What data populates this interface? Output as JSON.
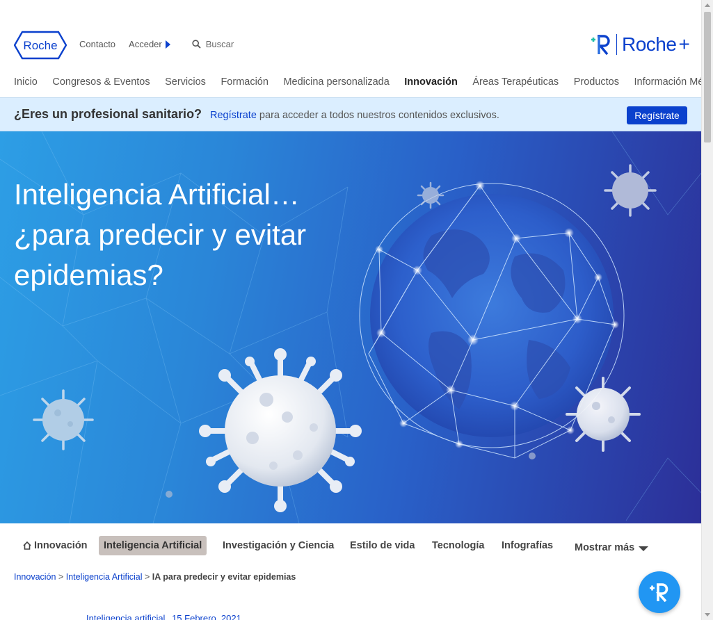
{
  "header": {
    "logo_text": "Roche",
    "links": {
      "contact": "Contacto",
      "login": "Acceder",
      "search": "Buscar"
    },
    "brand_plus": {
      "text": "Roche",
      "symbol": "+"
    }
  },
  "nav": {
    "items": [
      {
        "label": "Inicio"
      },
      {
        "label": "Congresos & Eventos"
      },
      {
        "label": "Servicios"
      },
      {
        "label": "Formación"
      },
      {
        "label": "Medicina personalizada"
      },
      {
        "label": "Innovación",
        "active": true
      },
      {
        "label": "Áreas Terapéuticas"
      },
      {
        "label": "Productos"
      },
      {
        "label": "Información Médica"
      }
    ]
  },
  "pro_banner": {
    "question": "¿Eres un profesional sanitario?",
    "link": "Regístrate",
    "text": " para acceder a todos nuestros contenidos exclusivos.",
    "button": "Regístrate"
  },
  "hero": {
    "title_line1": "Inteligencia Artificial…",
    "title_line2": "¿para predecir y evitar",
    "title_line3": "epidemias?"
  },
  "tabs": {
    "items": [
      {
        "label": "Innovación",
        "icon": "home-icon"
      },
      {
        "label": "Inteligencia Artificial",
        "active": true
      },
      {
        "label": "Investigación y Ciencia"
      },
      {
        "label": "Estilo de vida"
      },
      {
        "label": "Tecnología"
      },
      {
        "label": "Infografías"
      },
      {
        "label": "Mostrar más",
        "icon": "caret-down-icon"
      }
    ]
  },
  "breadcrumb": {
    "items": [
      "Innovación",
      "Inteligencia Artificial"
    ],
    "separator": " > ",
    "current": "IA para predecir y evitar epidemias"
  },
  "article": {
    "category": "Inteligencia artificial",
    "date": "15 Febrero, 2021"
  },
  "colors": {
    "brand_blue": "#0b41cd",
    "banner_bg": "#dbeeff",
    "tab_active": "#c8c0bc",
    "fab": "#2196f3"
  }
}
